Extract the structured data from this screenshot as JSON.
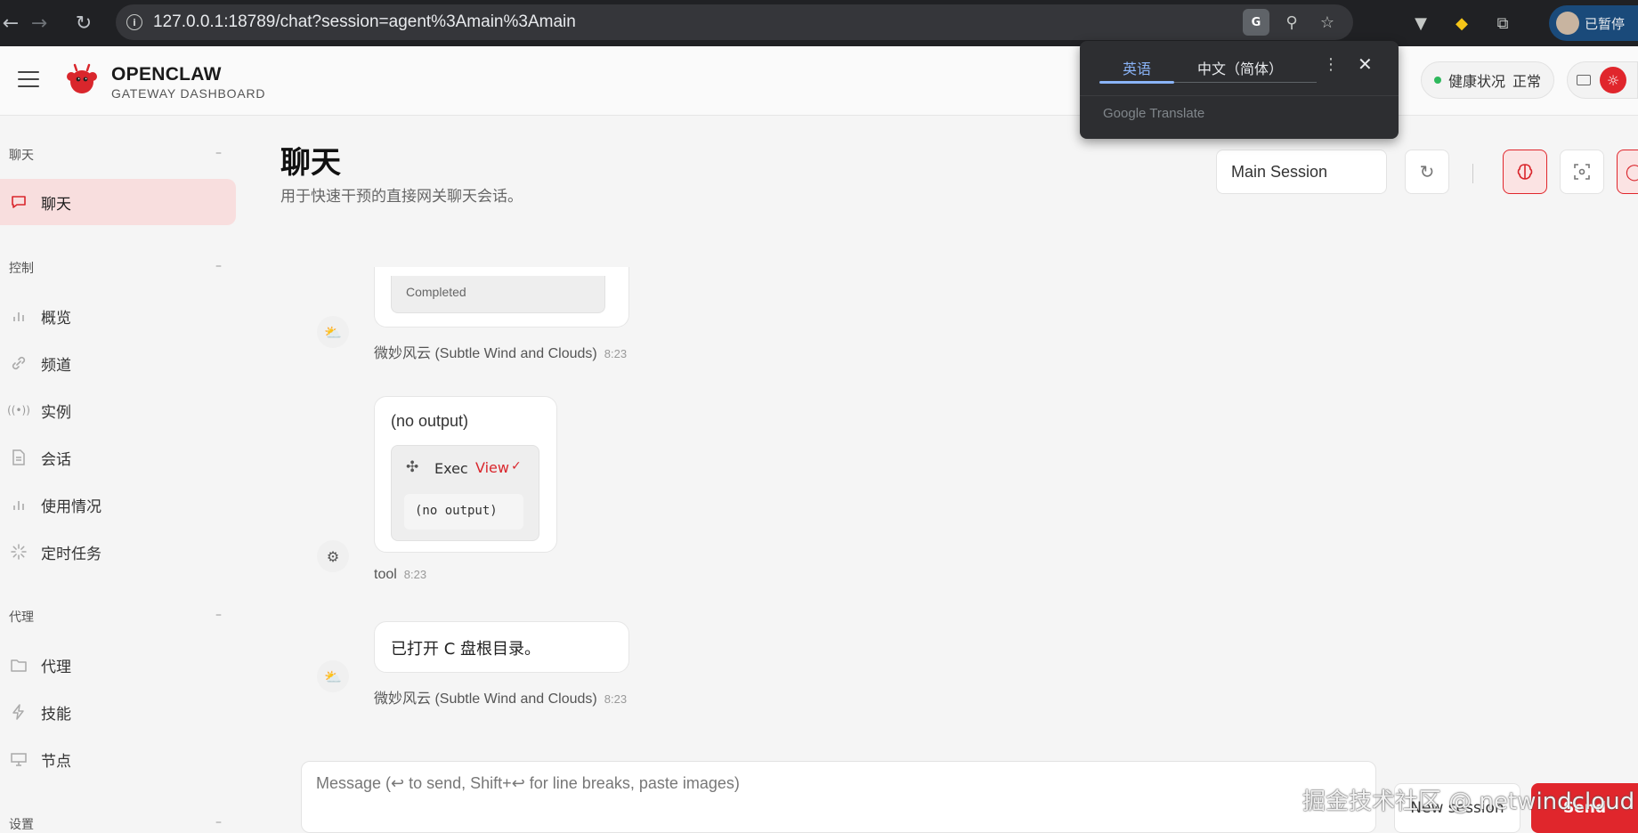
{
  "browser": {
    "url": "127.0.0.1:18789/chat?session=agent%3Amain%3Amain",
    "profile_label": "已暂停"
  },
  "app": {
    "brand_title": "OPENCLAW",
    "brand_subtitle": "GATEWAY DASHBOARD",
    "health_label": "健康状况",
    "health_status": "正常"
  },
  "translate_popup": {
    "tab_source": "英语",
    "tab_target": "中文（简体）",
    "brand": "Google Translate"
  },
  "sidebar": {
    "sections": [
      {
        "title": "聊天",
        "collapse": "–"
      },
      {
        "title": "控制",
        "collapse": "–"
      },
      {
        "title": "代理",
        "collapse": "–"
      },
      {
        "title": "设置",
        "collapse": "–"
      }
    ],
    "items": [
      {
        "label": "聊天",
        "icon": "chat-bubble-icon"
      },
      {
        "label": "概览",
        "icon": "bar-chart-icon"
      },
      {
        "label": "频道",
        "icon": "link-icon"
      },
      {
        "label": "实例",
        "icon": "broadcast-icon"
      },
      {
        "label": "会话",
        "icon": "document-icon"
      },
      {
        "label": "使用情况",
        "icon": "bar-chart-icon"
      },
      {
        "label": "定时任务",
        "icon": "loader-icon"
      },
      {
        "label": "代理",
        "icon": "folder-icon"
      },
      {
        "label": "技能",
        "icon": "lightning-icon"
      },
      {
        "label": "节点",
        "icon": "monitor-icon"
      }
    ]
  },
  "main": {
    "title": "聊天",
    "subtitle": "用于快速干预的直接网关聊天会话。",
    "session_select": "Main Session"
  },
  "messages": [
    {
      "status": "Completed",
      "sender": "微妙风云 (Subtle Wind and Clouds)",
      "time": "8:23"
    },
    {
      "text": "(no output)",
      "tool_name": "Exec",
      "tool_action": "View",
      "tool_output": "(no output)",
      "sender": "tool",
      "time": "8:23"
    },
    {
      "text": "已打开 C 盘根目录。",
      "sender": "微妙风云 (Subtle Wind and Clouds)",
      "time": "8:23"
    }
  ],
  "composer": {
    "placeholder": "Message (↩ to send, Shift+↩ for line breaks, paste images)",
    "new_session": "New session",
    "send": "Send"
  },
  "watermark": "掘金技术社区 @ netwindcloud",
  "colors": {
    "accent": "#e0262c",
    "active_bg": "#f8dede",
    "health_dot": "#2eb85c",
    "translate_accent": "#8ab4f8"
  }
}
